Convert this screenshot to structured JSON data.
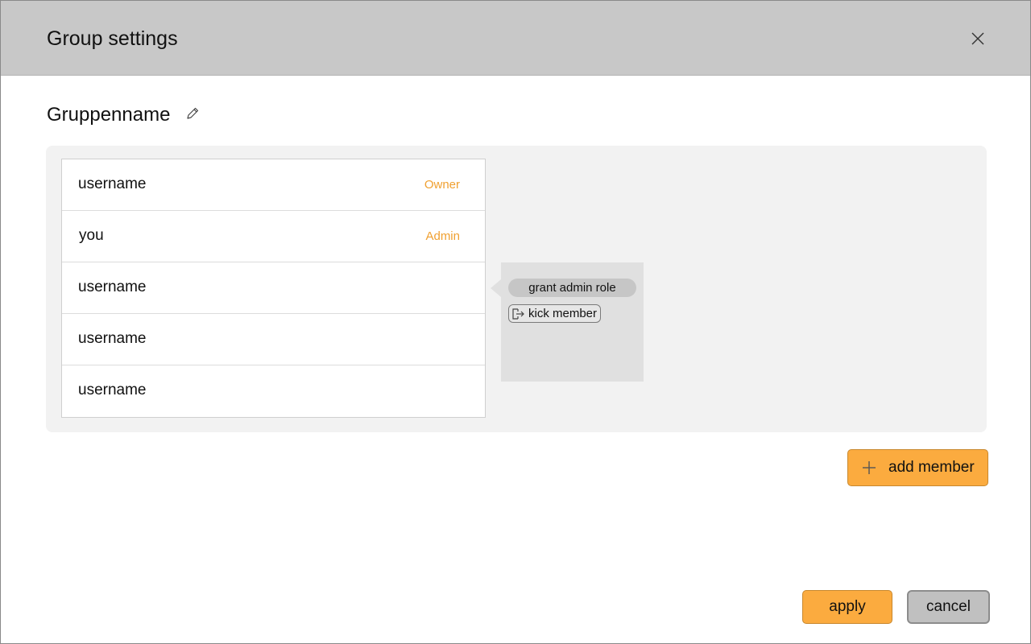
{
  "dialog": {
    "title": "Group settings",
    "close_icon": "close-icon"
  },
  "group": {
    "name": "Gruppenname",
    "edit_icon": "pencil-icon"
  },
  "members": [
    {
      "name": "username",
      "role": "Owner"
    },
    {
      "name": "you",
      "role": "Admin"
    },
    {
      "name": "username",
      "role": ""
    },
    {
      "name": "username",
      "role": ""
    },
    {
      "name": "username",
      "role": ""
    }
  ],
  "context_menu": {
    "grant_label": "grant admin role",
    "kick_label": "kick member",
    "kick_icon": "exit-icon"
  },
  "actions": {
    "add_member_label": "add member",
    "add_icon": "plus-icon",
    "apply_label": "apply",
    "cancel_label": "cancel"
  },
  "colors": {
    "accent": "#fbab3f",
    "role_text": "#f0a030",
    "header_bg": "#c8c8c8",
    "panel_bg": "#f2f2f2",
    "menu_bg": "#e0e0e0"
  }
}
